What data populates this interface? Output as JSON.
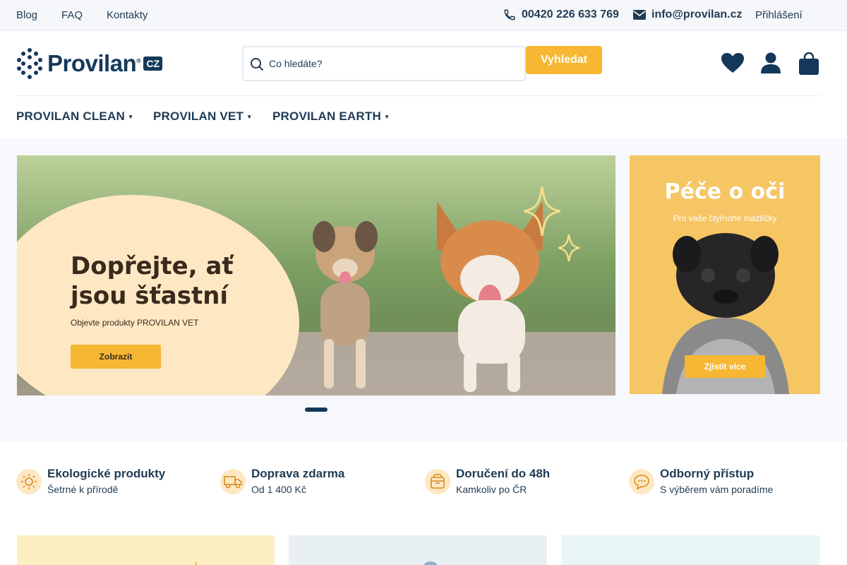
{
  "topbar": {
    "links": [
      "Blog",
      "FAQ",
      "Kontakty"
    ],
    "phone": "00420 226 633 769",
    "email": "info@provilan.cz",
    "login": "Přihlášení"
  },
  "logo": {
    "name": "Provilan",
    "reg": "®",
    "country": "CZ"
  },
  "search": {
    "placeholder": "Co hledáte?",
    "value": "",
    "button": "Vyhledat"
  },
  "header_icons": [
    "heart-icon",
    "user-icon",
    "bag-icon"
  ],
  "nav": [
    {
      "label": "PROVILAN CLEAN"
    },
    {
      "label": "PROVILAN VET"
    },
    {
      "label": "PROVILAN EARTH"
    }
  ],
  "hero": {
    "headline": "Dopřejte, ať jsou šťastní",
    "subtitle": "Objevte produkty PROVILAN VET",
    "cta": "Zobrazit"
  },
  "side_banner": {
    "title": "Péče o oči",
    "subtitle": "Pro vaše čtyřnohé mazlíčky",
    "cta": "Zjistit více"
  },
  "benefits": [
    {
      "icon": "sun-icon",
      "title": "Ekologické produkty",
      "subtitle": "Šetrné k přírodě"
    },
    {
      "icon": "truck-icon",
      "title": "Doprava zdarma",
      "subtitle": "Od 1 400 Kč"
    },
    {
      "icon": "box-icon",
      "title": "Doručení do 48h",
      "subtitle": "Kamkoliv po ČR"
    },
    {
      "icon": "chat-icon",
      "title": "Odborný přístup",
      "subtitle": "S výběrem vám poradíme"
    }
  ],
  "colors": {
    "brand": "#14385a",
    "accent": "#f7b733",
    "cream": "#fde8c3"
  }
}
